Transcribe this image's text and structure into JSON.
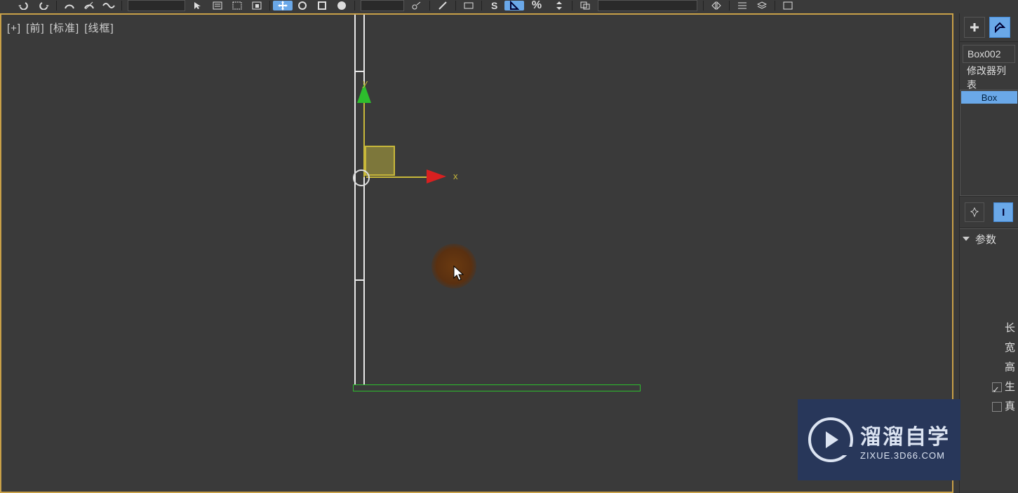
{
  "viewport": {
    "plus": "[+]",
    "view": "[前]",
    "shading": "[标准]",
    "style": "[线框]",
    "axis_x": "x",
    "axis_y": "y"
  },
  "side": {
    "object_name": "Box002",
    "modifier_list_label": "修改器列表",
    "modifier_item": "Box",
    "stack_pin_icon": "📌",
    "stack_show_i": "I"
  },
  "rollout": {
    "title": "参数"
  },
  "params": {
    "length_label": "长",
    "width_label": "宽",
    "height_label": "高",
    "gen_label": "生",
    "real_label": "真"
  },
  "watermark": {
    "big": "溜溜自学",
    "small": "ZIXUE.3D66.COM"
  },
  "toolbar": {
    "percent": "%"
  }
}
